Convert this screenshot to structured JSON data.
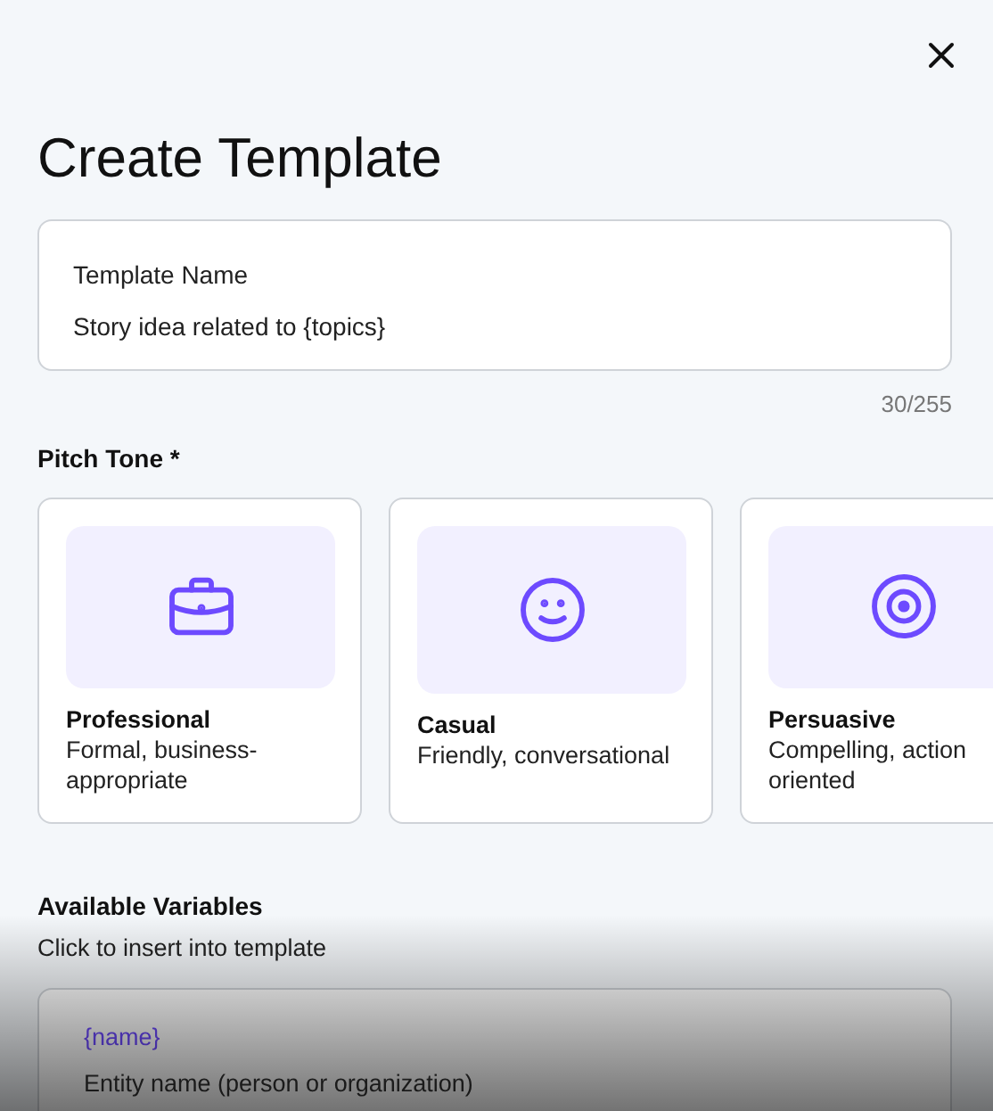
{
  "title": "Create Template",
  "template_name": {
    "label": "Template Name",
    "value": "Story idea related to {topics}",
    "counter": "30/255"
  },
  "pitch_tone": {
    "label": "Pitch Tone *",
    "options": [
      {
        "kind": "briefcase",
        "name": "Professional",
        "description": "Formal, business-appropriate",
        "selected": false
      },
      {
        "kind": "smile",
        "name": "Casual",
        "description": "Friendly, conversational",
        "selected": false
      },
      {
        "kind": "target",
        "name": "Persuasive",
        "description": "Compelling, action oriented",
        "selected": false
      }
    ]
  },
  "variables": {
    "title": "Available Variables",
    "hint": "Click to insert into template",
    "items": [
      {
        "token": "{name}",
        "description": "Entity name (person or organization)"
      }
    ]
  }
}
